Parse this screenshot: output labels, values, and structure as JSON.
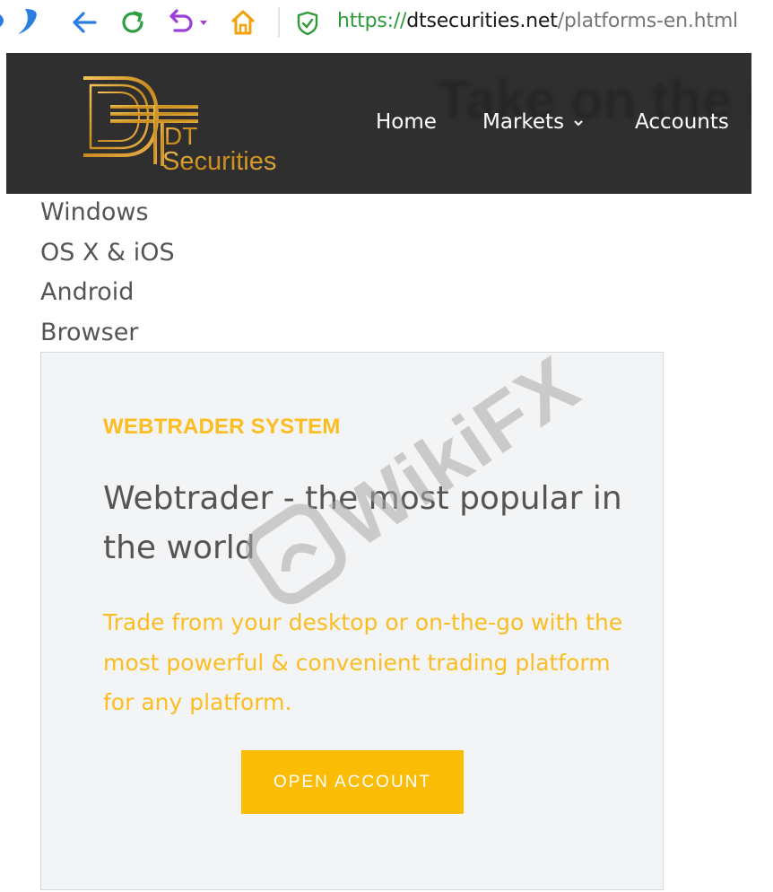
{
  "browser": {
    "url_scheme": "https://",
    "url_host": "dtsecurities.net",
    "url_path": "/platforms-en.html"
  },
  "header": {
    "logo_line1": "DT",
    "logo_line2": "Securities",
    "ghost_text": "Take on the m",
    "nav": [
      {
        "label": "Home"
      },
      {
        "label": "Markets"
      },
      {
        "label": "Accounts"
      }
    ]
  },
  "platforms": [
    "Windows",
    "OS X & iOS",
    "Android",
    "Browser"
  ],
  "card": {
    "kicker": "WEBTRADER SYSTEM",
    "title": "Webtrader - the most popular in the world",
    "description": "Trade from your desktop or on-the-go with the most powerful & convenient trading platform for any platform.",
    "button_label": "OPEN ACCOUNT"
  },
  "watermark": {
    "text": "WikiFX"
  },
  "colors": {
    "accent": "#fbbc05",
    "header_bg": "#2f2f2f",
    "card_bg": "#f3f4f6",
    "secure_green": "#2e9a3a"
  }
}
